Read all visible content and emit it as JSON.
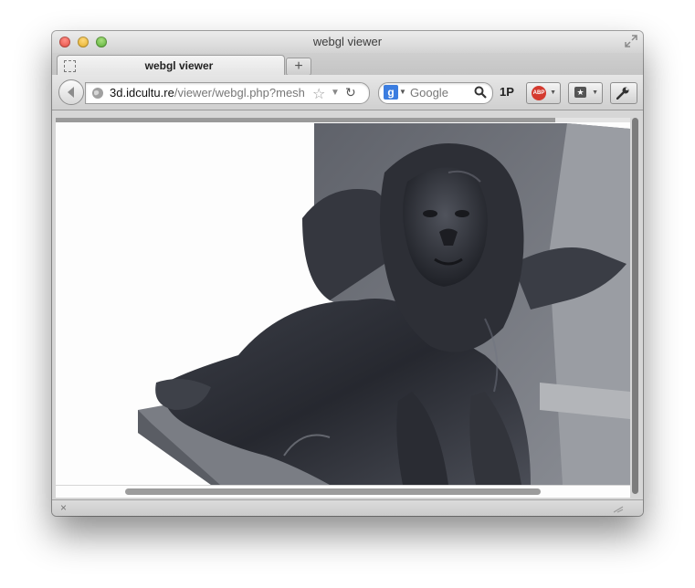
{
  "window": {
    "title": "webgl viewer"
  },
  "tabs": [
    {
      "label": "webgl viewer",
      "active": true
    }
  ],
  "newtab": {
    "label": "+"
  },
  "navbar": {
    "url_host": "3d.idcultu.re",
    "url_path": "/viewer/webgl.php?mesh",
    "search_placeholder": "Google",
    "search_engine_letter": "g",
    "onepassword_label": "1P",
    "abp_label": "ABP"
  },
  "statusbar": {
    "close_label": "×"
  },
  "page": {
    "load_progress": 0.87
  },
  "icons": {
    "back": "back-arrow-icon",
    "site": "globe-icon",
    "bookmark_star": "star-icon",
    "reload": "reload-icon",
    "search": "magnifier-icon",
    "adblock": "abp-icon",
    "bookmarks": "bookmarks-icon",
    "tools": "wrench-icon"
  },
  "colors": {
    "close": "#e0443a",
    "minimize": "#e0a91f",
    "maximize": "#4fa82d",
    "abp": "#d43a2f",
    "google_blue": "#3b7de0"
  }
}
